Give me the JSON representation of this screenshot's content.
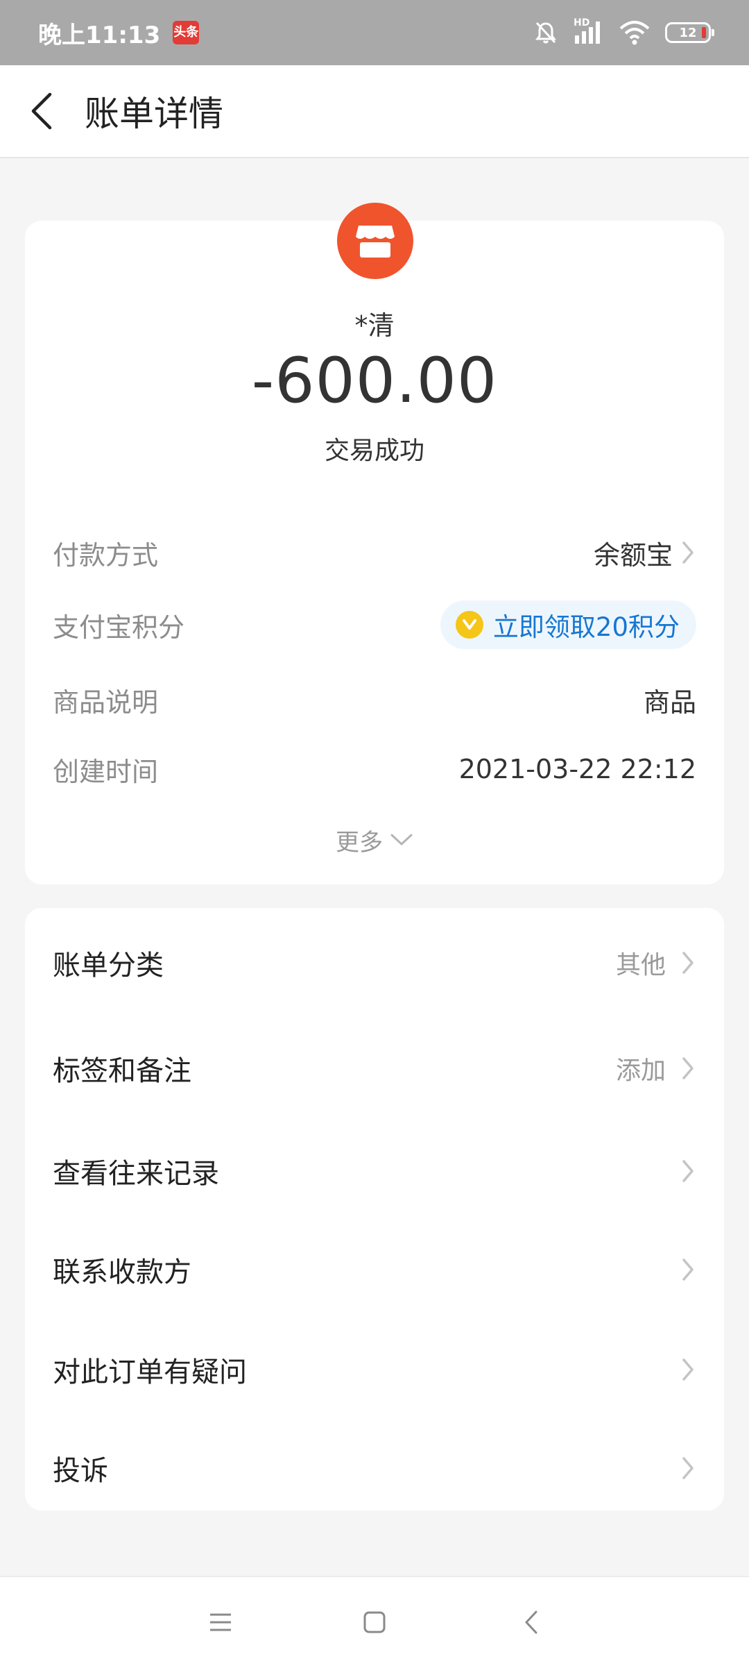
{
  "status_bar": {
    "time": "晚上11:13",
    "app_badge": "头条",
    "network": "HD",
    "battery": "12"
  },
  "header": {
    "title": "账单详情"
  },
  "transaction": {
    "merchant": "*清",
    "amount": "-600.00",
    "status": "交易成功",
    "avatar_color": "#f0542d"
  },
  "details": [
    {
      "label": "付款方式",
      "value": "余额宝"
    },
    {
      "label": "支付宝积分",
      "value": "立即领取20积分"
    },
    {
      "label": "商品说明",
      "value": "商品"
    },
    {
      "label": "创建时间",
      "value": "2021-03-22 22:12"
    }
  ],
  "more_label": "更多",
  "menu": [
    {
      "label": "账单分类",
      "value": "其他"
    },
    {
      "label": "标签和备注",
      "value": "添加"
    },
    {
      "label": "查看往来记录",
      "value": ""
    },
    {
      "label": "联系收款方",
      "value": ""
    },
    {
      "label": "对此订单有疑问",
      "value": ""
    },
    {
      "label": "投诉",
      "value": ""
    }
  ],
  "colors": {
    "accent_blue": "#1677d2",
    "merchant_orange": "#f0542d",
    "coin_yellow": "#f5c518"
  },
  "icons": {
    "back": "chevron-left-icon",
    "store": "store-icon",
    "coin": "coin-icon",
    "chevron": "chevron-right-icon",
    "more": "chevron-down-icon"
  }
}
